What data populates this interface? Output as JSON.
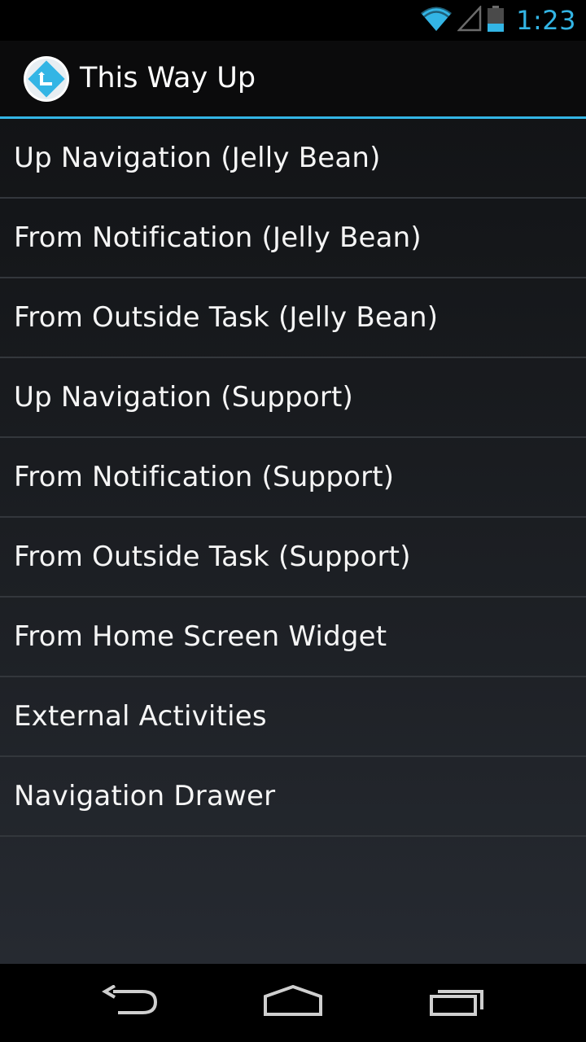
{
  "status_bar": {
    "time": "1:23",
    "icons": [
      "wifi-icon",
      "cell-signal-icon",
      "battery-icon"
    ],
    "accent_color": "#33b5e5"
  },
  "action_bar": {
    "title": "This Way Up",
    "icon": "app-up-arrow-icon",
    "accent_color": "#33b5e5"
  },
  "list": {
    "items": [
      {
        "label": "Up Navigation (Jelly Bean)"
      },
      {
        "label": "From Notification (Jelly Bean)"
      },
      {
        "label": "From Outside Task (Jelly Bean)"
      },
      {
        "label": "Up Navigation (Support)"
      },
      {
        "label": "From Notification (Support)"
      },
      {
        "label": "From Outside Task (Support)"
      },
      {
        "label": "From Home Screen Widget"
      },
      {
        "label": "External Activities"
      },
      {
        "label": "Navigation Drawer"
      }
    ]
  },
  "nav_bar": {
    "buttons": [
      "back-icon",
      "home-icon",
      "recents-icon"
    ]
  }
}
